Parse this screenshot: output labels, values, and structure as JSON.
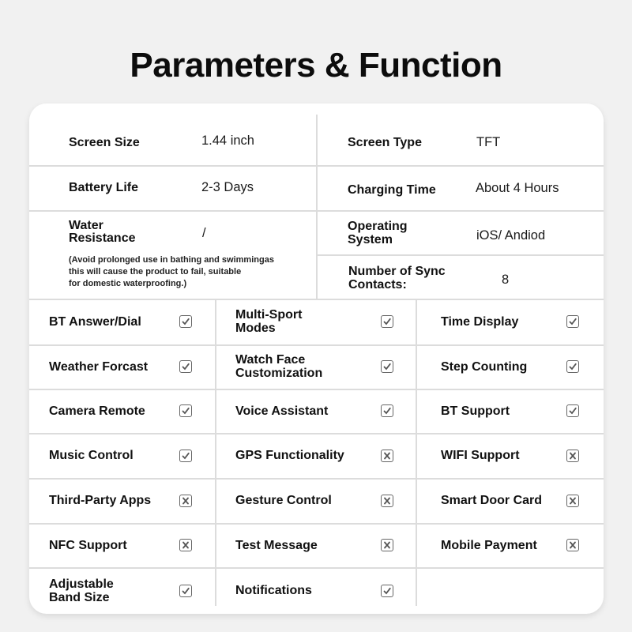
{
  "title": "Parameters & Function",
  "parameters": {
    "left": [
      {
        "label": "Screen Size",
        "value": "1.44 inch"
      },
      {
        "label": "Battery Life",
        "value": "2-3 Days"
      },
      {
        "label": "Water\nResistance",
        "value": "/",
        "note": "(Avoid prolonged use in bathing and swimmingas\nthis will cause the product to fail, suitable\nfor domestic waterproofing.)"
      }
    ],
    "right": [
      {
        "label": "Screen Type",
        "value": "TFT"
      },
      {
        "label": "Charging Time",
        "value": "About 4 Hours"
      },
      {
        "label": "Operating\nSystem",
        "value": "iOS/ Andiod"
      },
      {
        "label": "Number of Sync\nContacts:",
        "value": "8"
      }
    ]
  },
  "features": [
    [
      {
        "label": "BT Answer/Dial",
        "supported": true
      },
      {
        "label": "Multi-Sport\nModes",
        "supported": true
      },
      {
        "label": "Time Display",
        "supported": true
      }
    ],
    [
      {
        "label": "Weather Forcast",
        "supported": true
      },
      {
        "label": "Watch Face\nCustomization",
        "supported": true
      },
      {
        "label": "Step Counting",
        "supported": true
      }
    ],
    [
      {
        "label": "Camera Remote",
        "supported": true
      },
      {
        "label": "Voice Assistant",
        "supported": true
      },
      {
        "label": "BT Support",
        "supported": true
      }
    ],
    [
      {
        "label": "Music Control",
        "supported": true
      },
      {
        "label": "GPS Functionality",
        "supported": false
      },
      {
        "label": "WIFI Support",
        "supported": false
      }
    ],
    [
      {
        "label": "Third-Party Apps",
        "supported": false
      },
      {
        "label": "Gesture Control",
        "supported": false
      },
      {
        "label": "Smart Door Card",
        "supported": false
      }
    ],
    [
      {
        "label": "NFC Support",
        "supported": false
      },
      {
        "label": "Test Message",
        "supported": false
      },
      {
        "label": "Mobile Payment",
        "supported": false
      }
    ],
    [
      {
        "label": "Adjustable\nBand Size",
        "supported": true
      },
      {
        "label": "Notifications",
        "supported": true
      }
    ]
  ],
  "icons": {
    "supported": "checkbox-checked-icon",
    "unsupported": "checkbox-x-icon"
  }
}
